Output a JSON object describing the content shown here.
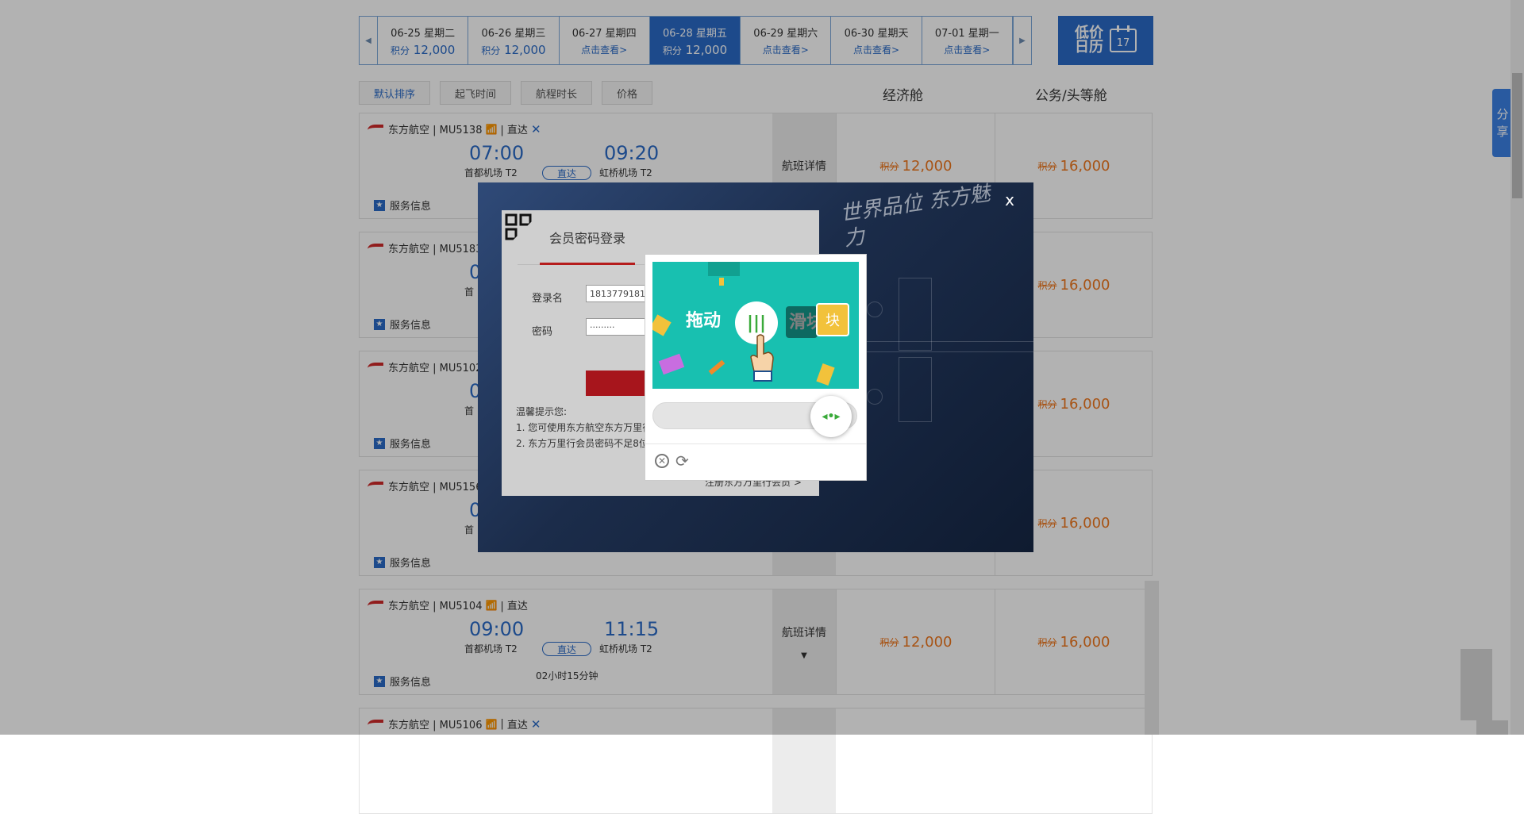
{
  "dates": [
    {
      "date": "06-25 星期二",
      "points_label": "积分",
      "price": "12,000"
    },
    {
      "date": "06-26 星期三",
      "points_label": "积分",
      "price": "12,000"
    },
    {
      "date": "06-27 星期四",
      "link": "点击查看>"
    },
    {
      "date": "06-28 星期五",
      "points_label": "积分",
      "price": "12,000",
      "active": true
    },
    {
      "date": "06-29 星期六",
      "link": "点击查看>"
    },
    {
      "date": "06-30 星期天",
      "link": "点击查看>"
    },
    {
      "date": "07-01 星期一",
      "link": "点击查看>"
    }
  ],
  "calendar": {
    "label": "低价日历",
    "day": "17"
  },
  "sort": {
    "items": [
      "默认排序",
      "起飞时间",
      "航程时长",
      "价格"
    ]
  },
  "columns": {
    "economy": "经济舱",
    "business": "公务/头等舱"
  },
  "flights": [
    {
      "airline": "东方航空 | MU5138",
      "direct_tag": "直达",
      "dep_time": "07:00",
      "arr_time": "09:20",
      "dep_airport": "首都机场 T2",
      "arr_airport": "虹桥机场 T2",
      "duration": "",
      "detail": "航班详情",
      "points_label": "积分",
      "economy": "12,000",
      "business": "16,000",
      "service": "服务信息"
    },
    {
      "airline": "东方航空 | MU5183 | ",
      "direct_tag": "",
      "dep_time": "0",
      "arr_time": "",
      "dep_airport": "首",
      "arr_airport": "",
      "duration": "",
      "detail": "",
      "points_label": "积分",
      "economy": "",
      "business": "16,000",
      "service": "服务信息"
    },
    {
      "airline": "东方航空 | MU5102",
      "direct_tag": "",
      "dep_time": "0",
      "arr_time": "",
      "dep_airport": "首",
      "arr_airport": "",
      "duration": "",
      "detail": "",
      "points_label": "积分",
      "economy": "",
      "business": "16,000",
      "service": "服务信息"
    },
    {
      "airline": "东方航空 | MU5156",
      "direct_tag": "",
      "dep_time": "0",
      "arr_time": "",
      "dep_airport": "首",
      "arr_airport": "",
      "duration": "",
      "detail": "",
      "points_label": "积分",
      "economy": "",
      "business": "16,000",
      "service": "服务信息"
    },
    {
      "airline": "东方航空 | MU5104",
      "direct_tag": "直达",
      "dep_time": "09:00",
      "arr_time": "11:15",
      "dep_airport": "首都机场 T2",
      "arr_airport": "虹桥机场 T2",
      "duration": "02小时15分钟",
      "detail": "航班详情",
      "points_label": "积分",
      "economy": "12,000",
      "business": "16,000",
      "service": "服务信息"
    },
    {
      "airline": "东方航空 | MU5106",
      "direct_tag": "直达",
      "dep_time": "",
      "arr_time": "",
      "dep_airport": "",
      "arr_airport": "",
      "duration": "",
      "detail": "",
      "points_label": "",
      "economy": "",
      "business": "",
      "service": ""
    }
  ],
  "share": {
    "label1": "分",
    "label2": "享"
  },
  "login": {
    "close": "x",
    "tab": "会员密码登录",
    "username_label": "登录名",
    "username_value": "18137791813",
    "password_label": "密码",
    "password_value": "·········",
    "tips_title": "温馨提示您:",
    "tip1": "1. 您可使用东方航空东方万里行",
    "tip2": "2. 东方万里行会员密码不足8位",
    "foot": "注册东方万里行会员 >",
    "slogan": "世界品位 东方魅力"
  },
  "captcha": {
    "drag_text": "拖动",
    "slider_text": "滑块",
    "knob": "◂•▸",
    "close_icon": "close-icon",
    "refresh_icon": "refresh-icon"
  }
}
